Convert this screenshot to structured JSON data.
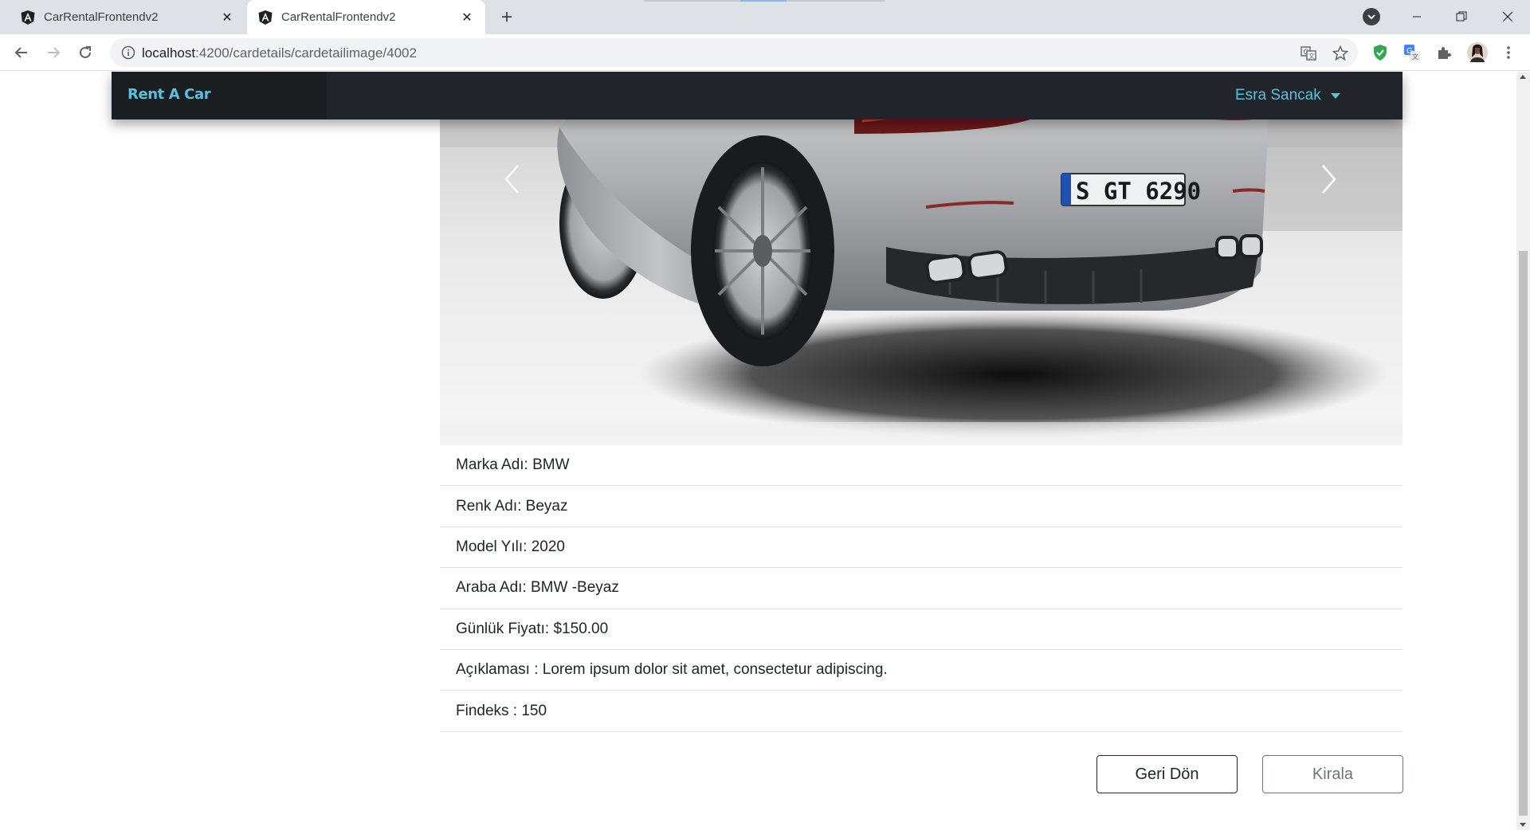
{
  "browser": {
    "tabs": [
      {
        "title": "CarRentalFrontendv2",
        "active": false,
        "icon": "angular-icon"
      },
      {
        "title": "CarRentalFrontendv2",
        "active": true,
        "icon": "angular-icon"
      }
    ],
    "address_host": "localhost",
    "address_path": ":4200/cardetails/cardetailimage/4002"
  },
  "navbar": {
    "brand": "Rent A Car",
    "user_name": "Esra Sancak"
  },
  "car_image": {
    "plate": "S GT 6290"
  },
  "details": [
    "Marka Adı: BMW",
    "Renk Adı: Beyaz",
    "Model Yılı: 2020",
    "Araba Adı: BMW -Beyaz",
    "Günlük Fiyatı: $150.00",
    "Açıklaması : Lorem ipsum dolor sit amet, consectetur adipiscing.",
    "Findeks : 150"
  ],
  "buttons": {
    "back": "Geri Dön",
    "rent": "Kirala"
  },
  "colors": {
    "navbar_bg": "#212529",
    "brand_accent": "#5bc0de",
    "list_divider": "#dee2e6"
  }
}
